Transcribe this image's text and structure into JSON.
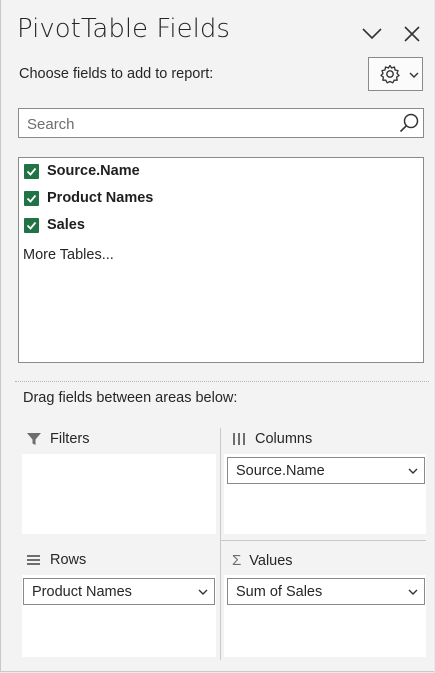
{
  "pane": {
    "title": "PivotTable Fields",
    "subtitle": "Choose fields to add to report:",
    "search_placeholder": "Search",
    "fields": [
      {
        "label": "Source.Name",
        "checked": true
      },
      {
        "label": "Product Names",
        "checked": true
      },
      {
        "label": "Sales",
        "checked": true
      }
    ],
    "more_tables": "More Tables...",
    "drag_text": "Drag fields between areas below:"
  },
  "areas": {
    "filters": {
      "label": "Filters",
      "icon": "filter-icon"
    },
    "columns": {
      "label": "Columns",
      "icon": "columns-icon",
      "item": "Source.Name"
    },
    "rows": {
      "label": "Rows",
      "icon": "rows-icon",
      "item": "Product Names"
    },
    "values": {
      "label": "Values",
      "icon": "sigma-icon",
      "item": "Sum of Sales",
      "symbol": "Σ"
    }
  },
  "colors": {
    "checkbox": "#217346",
    "border": "#8a8a8a",
    "pane_bg": "#f3f3f3"
  }
}
